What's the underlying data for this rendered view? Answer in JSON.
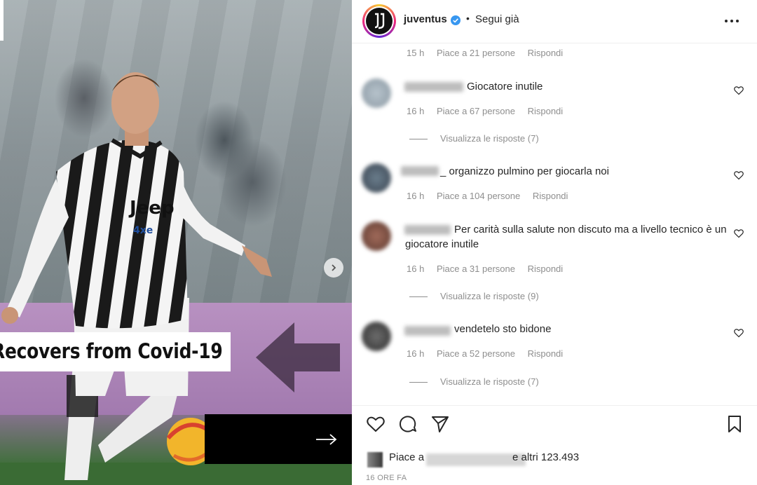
{
  "media": {
    "caption": "Recovers from Covid-19",
    "jersey_sponsor": "Jeep",
    "jersey_sub": "4xe",
    "badge": "J"
  },
  "header": {
    "username": "juventus",
    "separator": "•",
    "follow_state": "Segui già"
  },
  "comments": [
    {
      "time": "15 h",
      "likes": "Piace a 21 persone",
      "reply": "Rispondi"
    },
    {
      "text": "Giocatore inutile",
      "time": "16 h",
      "likes": "Piace a 67 persone",
      "reply": "Rispondi",
      "view_replies": "Visualizza le risposte (7)"
    },
    {
      "text": "_ organizzo pulmino per giocarla noi",
      "time": "16 h",
      "likes": "Piace a 104 persone",
      "reply": "Rispondi"
    },
    {
      "text": "Per carità sulla salute non discuto ma a livello tecnico è un giocatore inutile",
      "time": "16 h",
      "likes": "Piace a 31 persone",
      "reply": "Rispondi",
      "view_replies": "Visualizza le risposte (9)"
    },
    {
      "text": "vendetelo sto bidone",
      "time": "16 h",
      "likes": "Piace a 52 persone",
      "reply": "Rispondi",
      "view_replies": "Visualizza le risposte (7)"
    }
  ],
  "likes": {
    "prefix": "Piace a",
    "suffix": "e altri 123.493"
  },
  "time_ago": "16 ORE FA",
  "icons": {
    "like": "heart-icon",
    "comment": "comment-icon",
    "share": "paper-plane-icon",
    "save": "bookmark-icon",
    "more": "more-dots-icon",
    "verified": "verified-badge-icon",
    "next": "chevron-right-icon"
  },
  "colors": {
    "verified": "#3897f0",
    "text": "#262626",
    "muted": "#8e8e8e"
  }
}
